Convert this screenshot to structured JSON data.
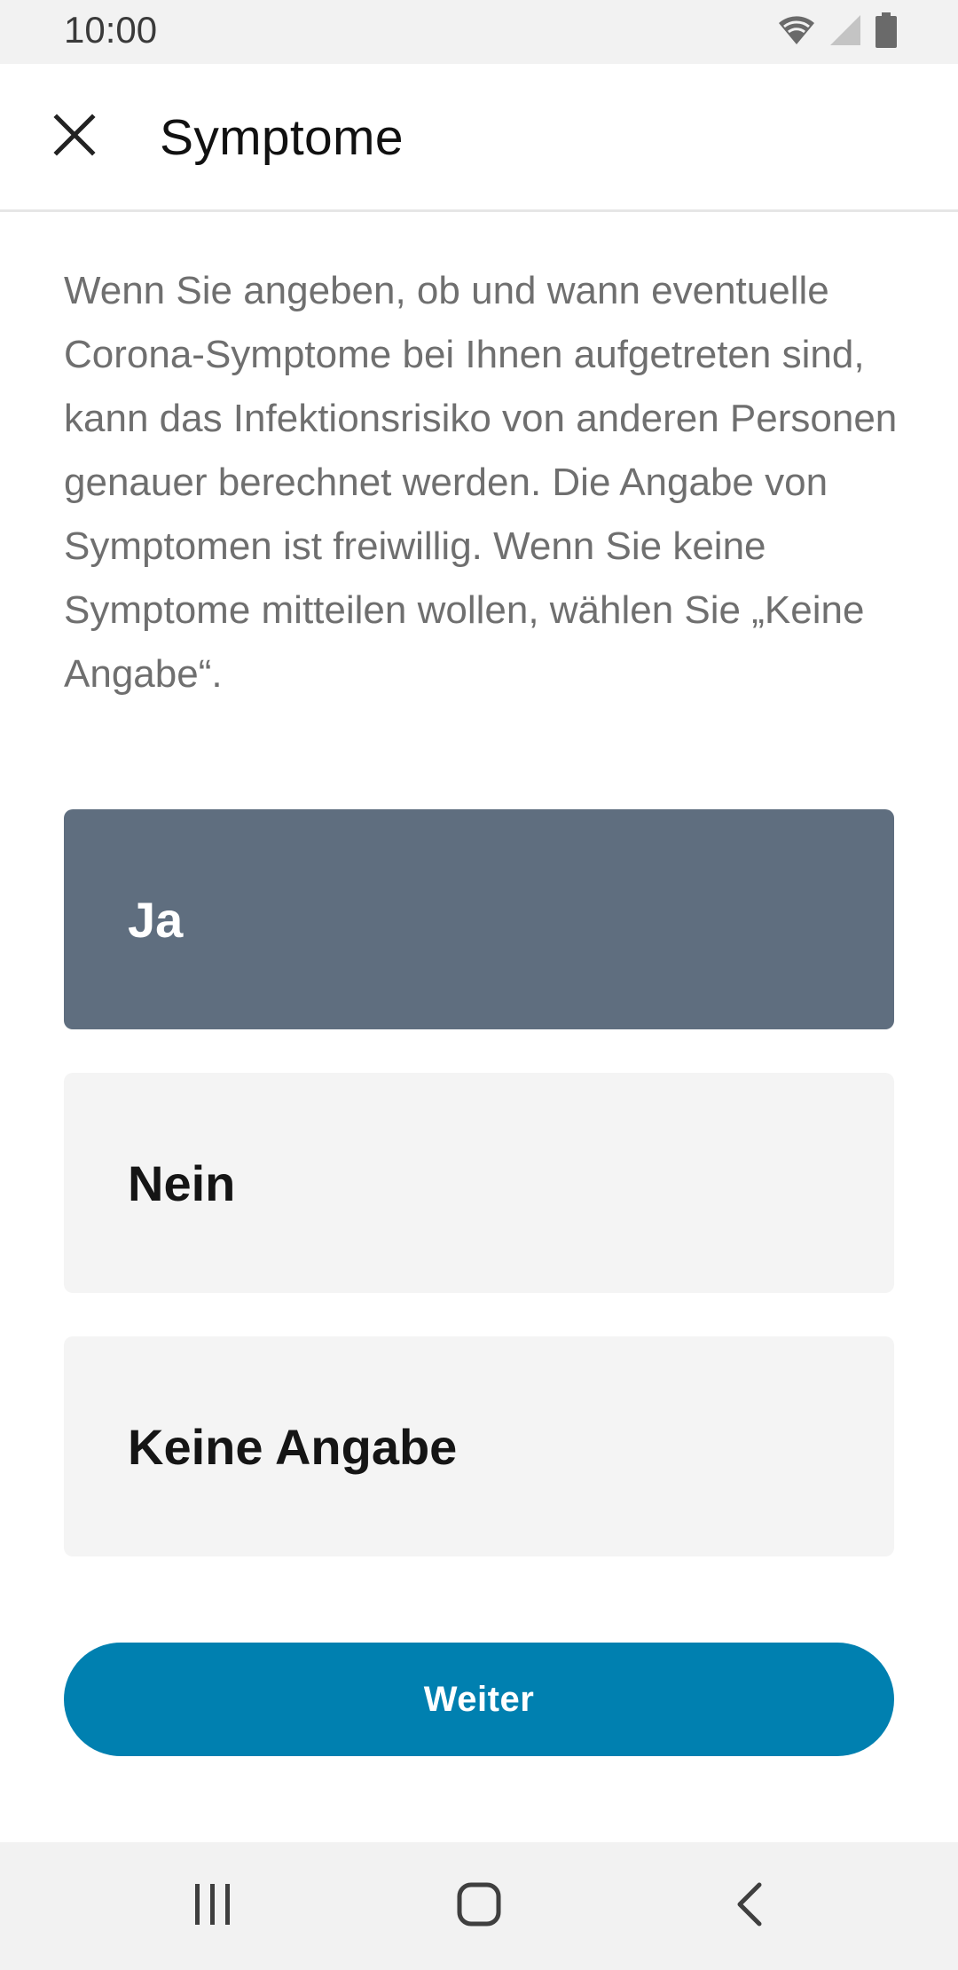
{
  "status_bar": {
    "time": "10:00",
    "icons": [
      "wifi-icon",
      "signal-icon",
      "battery-icon"
    ]
  },
  "app_bar": {
    "close_icon": "close-icon",
    "title": "Symptome"
  },
  "description": "Wenn Sie angeben, ob und wann eventuelle Corona-Symptome bei Ihnen aufgetreten sind, kann das Infektionsrisiko von anderen Personen genauer berechnet werden. Die Angabe von Symptomen ist freiwillig. Wenn Sie keine Symptome mitteilen wollen, wählen Sie „Keine Angabe“.",
  "options": [
    {
      "label": "Ja",
      "selected": true
    },
    {
      "label": "Nein",
      "selected": false
    },
    {
      "label": "Keine Angabe",
      "selected": false
    }
  ],
  "continue_button": {
    "label": "Weiter"
  },
  "nav_bar": {
    "icons": [
      "recent-apps-icon",
      "home-icon",
      "back-icon"
    ]
  },
  "colors": {
    "selected_option": "#5f6e7f",
    "unselected_option": "#f4f4f4",
    "primary_button": "#0080b0",
    "status_bar": "#f2f2f2"
  }
}
